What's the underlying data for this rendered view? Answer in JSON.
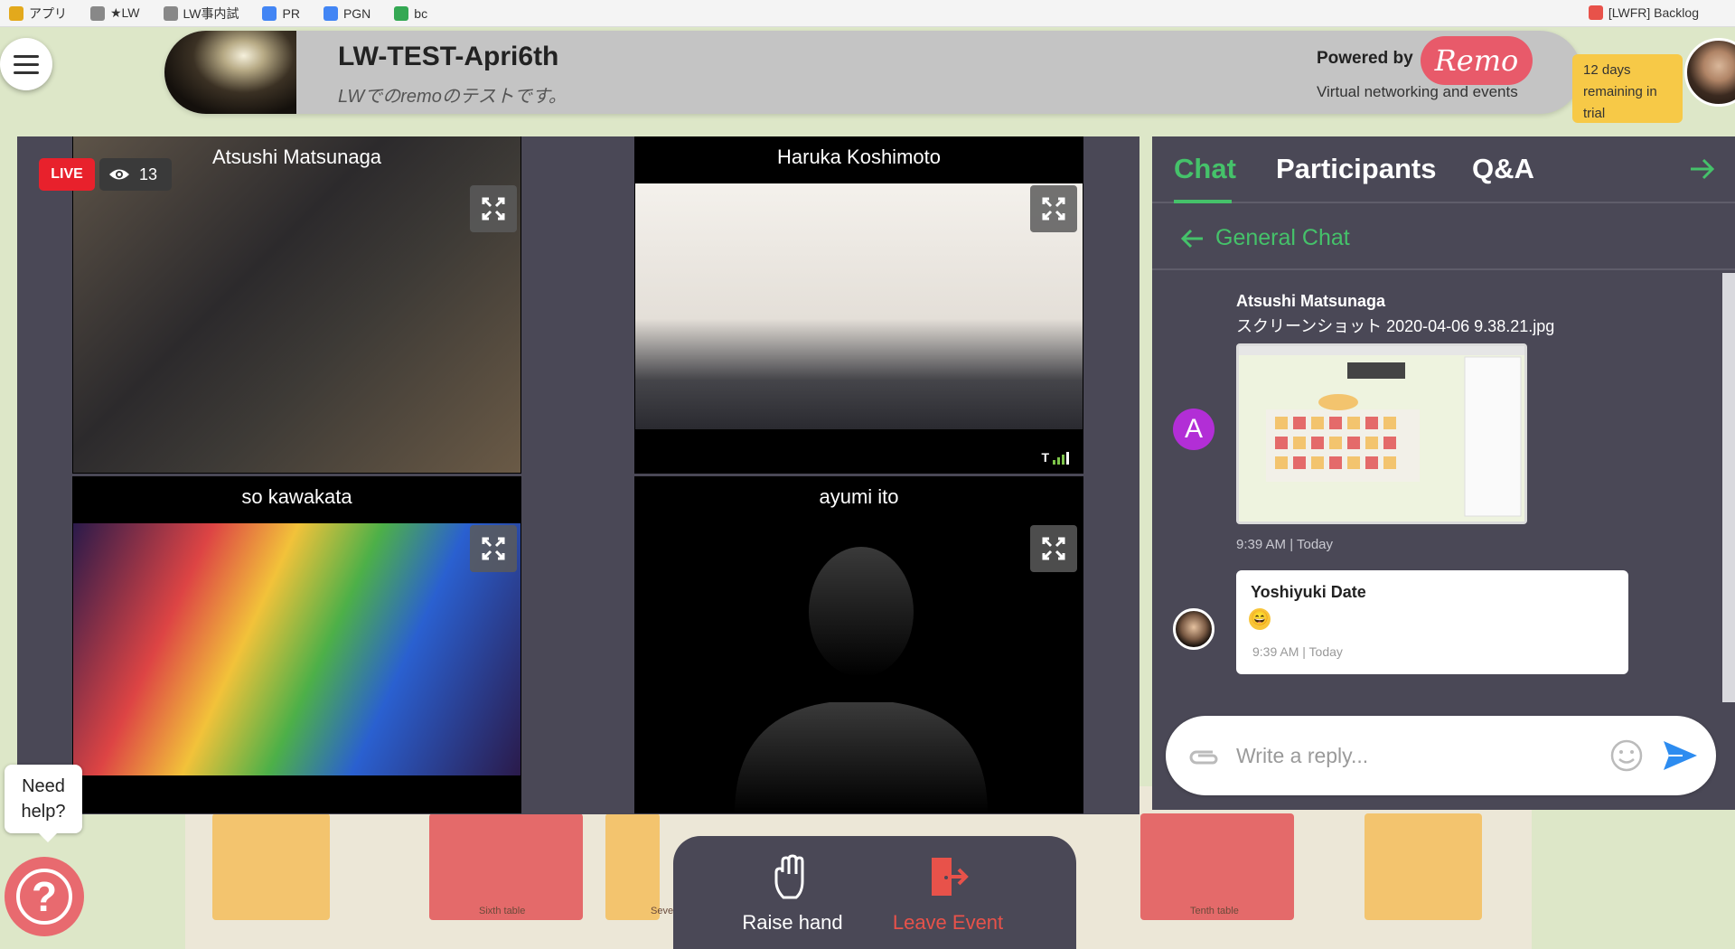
{
  "browser": {
    "bookmarks": [
      {
        "label": "アプリ",
        "color": "#e3a91c"
      },
      {
        "label": "★LW",
        "color": "#888888"
      },
      {
        "label": "LW事内試",
        "color": "#888888"
      },
      {
        "label": "PR",
        "color": "#4285f4"
      },
      {
        "label": "PGN",
        "color": "#4285f4"
      },
      {
        "label": "bc",
        "color": "#34a853"
      }
    ],
    "right_bookmark": "[LWFR] Backlog"
  },
  "header": {
    "title": "LW-TEST-Apri6th",
    "subtitle": "LWでのremoのテストです。",
    "powered_by": "Powered by",
    "brand": "Remo",
    "tagline": "Virtual networking and events",
    "trial": "12 days remaining in trial"
  },
  "stage": {
    "live": "LIVE",
    "viewers": "13",
    "tiles": [
      {
        "name": "Atsushi Matsunaga"
      },
      {
        "name": "Haruka Koshimoto"
      },
      {
        "name": "so kawakata"
      },
      {
        "name": "ayumi ito"
      }
    ]
  },
  "chat": {
    "tabs": [
      "Chat",
      "Participants",
      "Q&A"
    ],
    "active_tab": "Chat",
    "channel": "General Chat",
    "messages": [
      {
        "avatar": "A",
        "name": "Atsushi Matsunaga",
        "text": "スクリーンショット 2020-04-06 9.38.21.jpg",
        "time": "9:39 AM | Today"
      },
      {
        "name": "Yoshiyuki Date",
        "emoji": "😄",
        "time": "9:39 AM | Today"
      }
    ],
    "reply_placeholder": "Write a reply..."
  },
  "controls": {
    "raise_hand": "Raise hand",
    "leave": "Leave Event"
  },
  "floor": {
    "tables": [
      "Sixth table",
      "Seve",
      "Tenth table"
    ]
  },
  "help": {
    "text": "Need help?",
    "icon": "?"
  },
  "colors": {
    "accent_green": "#45c26a",
    "live_red": "#e8212c",
    "panel": "#4a4856",
    "leave_red": "#e8524a",
    "brand_pink": "#e85a6a"
  }
}
